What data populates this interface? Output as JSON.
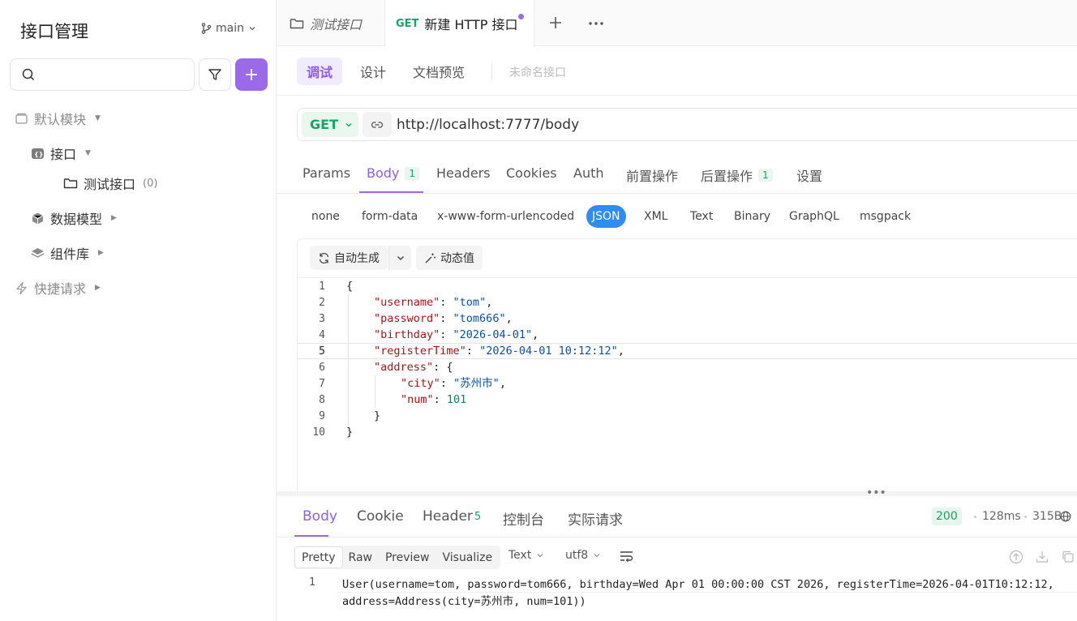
{
  "sidebar": {
    "title": "接口管理",
    "branch": "main",
    "search": {
      "placeholder": "",
      "value": ""
    },
    "tree": {
      "default_module": "默认模块",
      "interfaces": "接口",
      "folder": "测试接口",
      "folder_count": "(0)",
      "data_models": "数据模型",
      "components": "组件库",
      "quick_requests": "快捷请求"
    }
  },
  "tabs": {
    "inactive": "测试接口",
    "active_method": "GET",
    "active_title": "新建 HTTP 接口"
  },
  "mode_tabs": [
    "调试",
    "设计",
    "文档预览"
  ],
  "unnamed": "未命名接口",
  "request": {
    "method": "GET",
    "url": "http://localhost:7777/body"
  },
  "param_tabs": {
    "params": "Params",
    "body": "Body",
    "body_badge": "1",
    "headers": "Headers",
    "cookies": "Cookies",
    "auth": "Auth",
    "pre": "前置操作",
    "post": "后置操作",
    "post_badge": "1",
    "settings": "设置"
  },
  "body_types": [
    "none",
    "form-data",
    "x-www-form-urlencoded",
    "JSON",
    "XML",
    "Text",
    "Binary",
    "GraphQL",
    "msgpack"
  ],
  "editor_toolbar": {
    "auto_gen": "自动生成",
    "dynamic": "动态值"
  },
  "code_lines": [
    {
      "n": "1",
      "t": "{"
    },
    {
      "n": "2",
      "k": "\"username\"",
      "v": "\"tom\"",
      "end": ","
    },
    {
      "n": "3",
      "k": "\"password\"",
      "v": "\"tom666\"",
      "end": ","
    },
    {
      "n": "4",
      "k": "\"birthday\"",
      "v": "\"2026-04-01\"",
      "end": ","
    },
    {
      "n": "5",
      "k": "\"registerTime\"",
      "v": "\"2026-04-01 10:12:12\"",
      "end": ","
    },
    {
      "n": "6",
      "k": "\"address\"",
      "v": "{"
    },
    {
      "n": "7",
      "k": "\"city\"",
      "v": "\"苏州市\"",
      "end": ","
    },
    {
      "n": "8",
      "k": "\"num\"",
      "v": "101"
    },
    {
      "n": "9",
      "t": "}"
    },
    {
      "n": "10",
      "t": "}"
    }
  ],
  "response": {
    "tabs": {
      "body": "Body",
      "cookie": "Cookie",
      "header": "Header",
      "header_count": "5",
      "console": "控制台",
      "actual": "实际请求"
    },
    "status": "200",
    "time": "128ms",
    "size": "315B",
    "views": [
      "Pretty",
      "Raw",
      "Preview",
      "Visualize"
    ],
    "format": "Text",
    "encoding": "utf8",
    "line_no": "1",
    "line1": "User(username=tom, password=tom666, birthday=Wed Apr 01 00:00:00 CST 2026, registerTime=2026-04-01T10:12:12,",
    "line2": "address=Address(city=苏州市, num=101))"
  },
  "colors": {
    "accent": "#9a6ae8",
    "method": "#1aa366",
    "json_active": "#2f8cf1"
  }
}
